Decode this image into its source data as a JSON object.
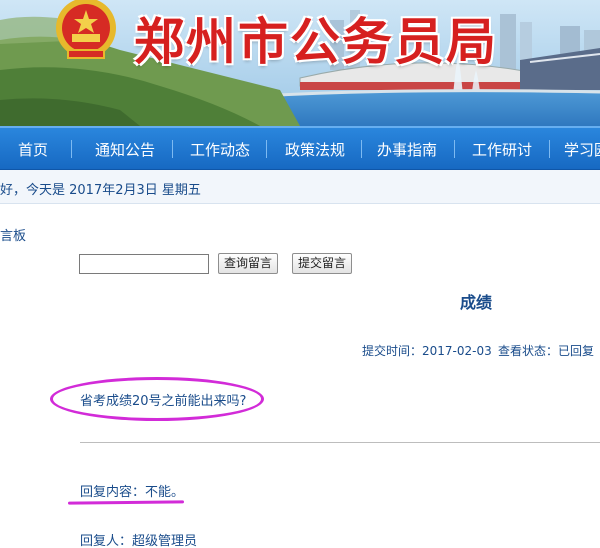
{
  "header": {
    "site_title": "郑州市公务员局",
    "emblem": "national-emblem-icon"
  },
  "nav": {
    "items": [
      {
        "label": "首页"
      },
      {
        "label": "通知公告"
      },
      {
        "label": "工作动态"
      },
      {
        "label": "政策法规"
      },
      {
        "label": "办事指南"
      },
      {
        "label": "工作研讨"
      },
      {
        "label": "学习园"
      }
    ]
  },
  "date_bar": {
    "text": "好，今天是  2017年2月3日  星期五"
  },
  "board": {
    "label": "言板"
  },
  "toolbar": {
    "search_value": "",
    "query_button": "查询留言",
    "submit_button": "提交留言"
  },
  "message": {
    "title": "成绩",
    "submit_time": "提交时间：2017-02-03",
    "status": "查看状态：已回复",
    "question": "省考成绩20号之前能出来吗?",
    "reply": "回复内容：不能。",
    "replier": "回复人：超级管理员"
  },
  "colors": {
    "nav_bg": "#1f77d0",
    "title_red": "#d6201f",
    "text_blue": "#1a4c8b",
    "annotation_magenta": "#d22bd8"
  }
}
